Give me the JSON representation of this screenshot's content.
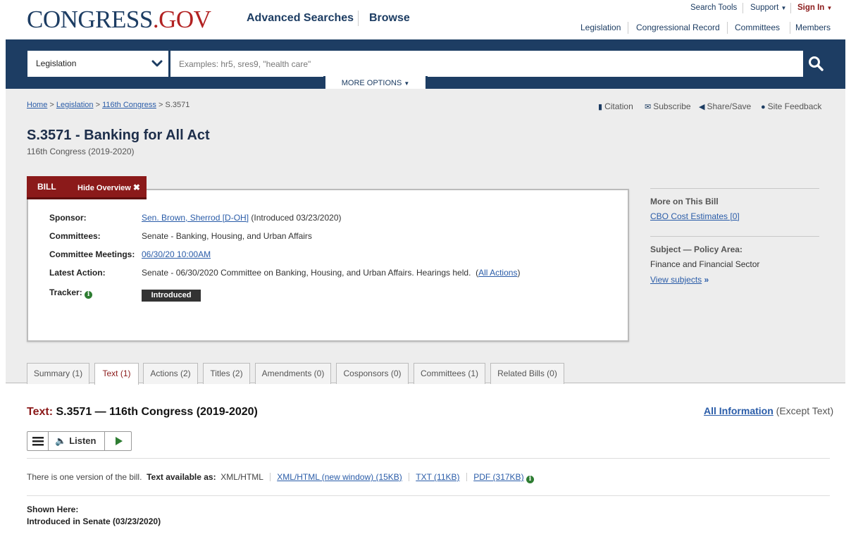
{
  "header": {
    "logo_main": "CONGRESS",
    "logo_dot": ".",
    "logo_tld": "GOV",
    "nav": [
      "Advanced Searches",
      "Browse"
    ],
    "top_links": {
      "search_tools": "Search Tools",
      "support": "Support",
      "sign_in": "Sign In"
    },
    "sub_links": [
      "Legislation",
      "Congressional Record",
      "Committees",
      "Members"
    ]
  },
  "search": {
    "scope": "Legislation",
    "placeholder": "Examples: hr5, sres9, \"health care\"",
    "value": "",
    "more_options": "MORE OPTIONS"
  },
  "breadcrumb": {
    "home": "Home",
    "legislation": "Legislation",
    "congress": "116th Congress",
    "current": "S.3571",
    "sep": ">"
  },
  "tools": [
    "Citation",
    "Subscribe",
    "Share/Save",
    "Site Feedback"
  ],
  "bill": {
    "title": "S.3571 - Banking for All Act",
    "subtitle": "116th Congress (2019-2020)",
    "tab_label": "BILL",
    "hide_overview": "Hide Overview",
    "overview": {
      "sponsor_label": "Sponsor:",
      "sponsor_link": "Sen. Brown, Sherrod [D-OH]",
      "sponsor_intro": "(Introduced 03/23/2020)",
      "committees_label": "Committees:",
      "committees_value": "Senate - Banking, Housing, and Urban Affairs",
      "meetings_label": "Committee Meetings:",
      "meetings_link": "06/30/20 10:00AM",
      "latest_label": "Latest Action:",
      "latest_value": "Senate - 06/30/2020 Committee on Banking, Housing, and Urban Affairs. Hearings held.",
      "all_actions": "All Actions",
      "tracker_label": "Tracker:",
      "tracker_status": "Introduced"
    }
  },
  "side": {
    "more_heading": "More on This Bill",
    "cbo_link": "CBO Cost Estimates [0]",
    "subject_heading": "Subject — Policy Area:",
    "subject_value": "Finance and Financial Sector",
    "view_subjects": "View subjects"
  },
  "tabs": [
    {
      "label": "Summary (1)"
    },
    {
      "label": "Text (1)"
    },
    {
      "label": "Actions (2)"
    },
    {
      "label": "Titles (2)"
    },
    {
      "label": "Amendments (0)"
    },
    {
      "label": "Cosponsors (0)"
    },
    {
      "label": "Committees (1)"
    },
    {
      "label": "Related Bills (0)"
    }
  ],
  "text_section": {
    "heading_prefix": "Text:",
    "heading_rest": "S.3571 — 116th Congress (2019-2020)",
    "all_info_link": "All Information",
    "all_info_suffix": "(Except Text)",
    "listen": "Listen",
    "versions_text": "There is one version of the bill.",
    "available_label": "Text available as:",
    "format_plain": "XML/HTML",
    "format_xml_new": "XML/HTML (new window) (15KB)",
    "format_txt": "TXT (11KB)",
    "format_pdf": "PDF (317KB)",
    "shown_here_label": "Shown Here:",
    "shown_here_value": "Introduced in Senate (03/23/2020)"
  },
  "colors": {
    "navy": "#1d3d63",
    "maroon": "#8b1a1a",
    "link": "#2a5ca8",
    "info_green": "#2e7d32"
  }
}
